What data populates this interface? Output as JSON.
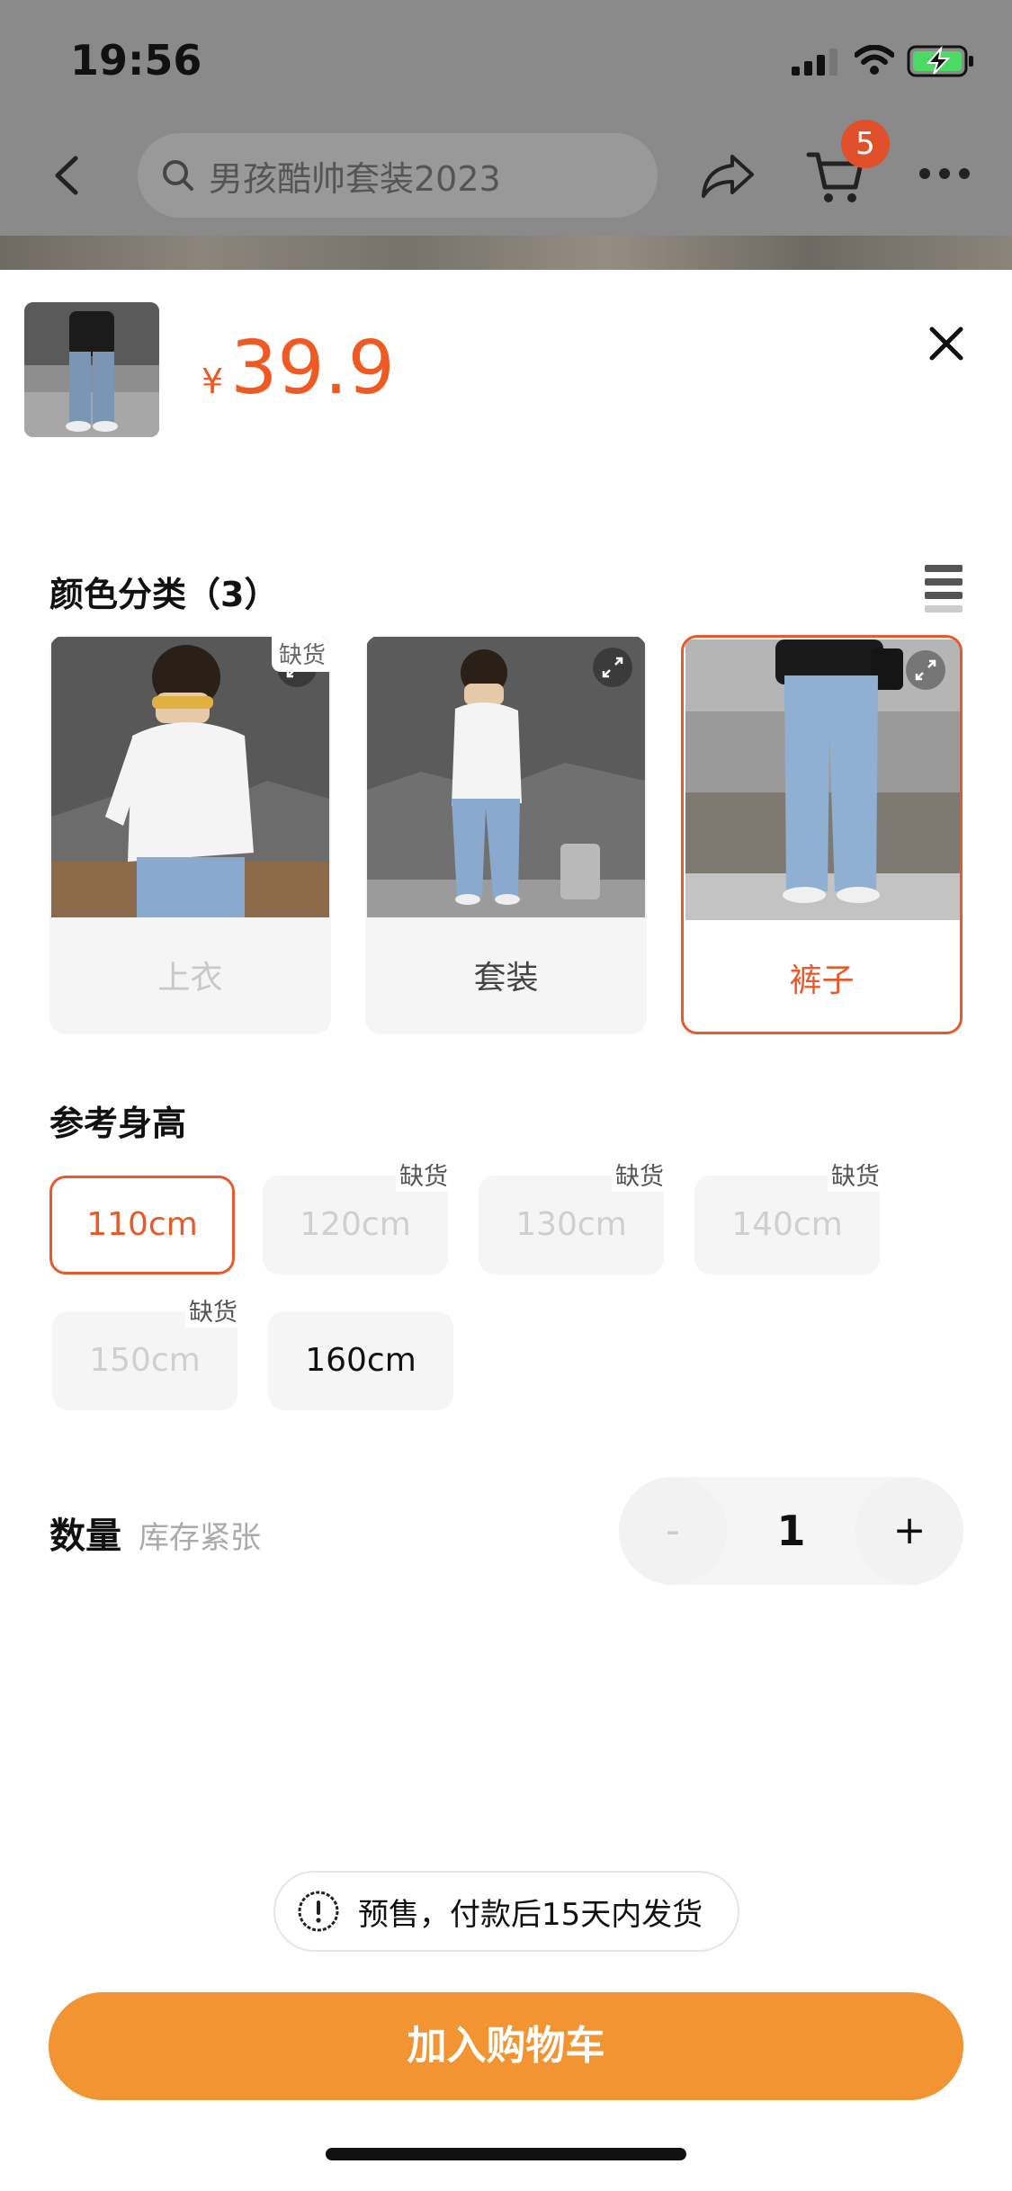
{
  "status": {
    "time": "19:56"
  },
  "nav": {
    "search_query": "男孩酷帅套装2023",
    "cart_count": "5"
  },
  "product": {
    "currency": "¥",
    "price": "39.9"
  },
  "color_section": {
    "title": "颜色分类（3）",
    "options": [
      {
        "label": "上衣",
        "status": "缺货",
        "state": "disabled"
      },
      {
        "label": "套装",
        "status": "",
        "state": "normal"
      },
      {
        "label": "裤子",
        "status": "",
        "state": "selected"
      }
    ]
  },
  "size_section": {
    "title": "参考身高",
    "options": [
      {
        "label": "110cm",
        "status": "",
        "state": "selected"
      },
      {
        "label": "120cm",
        "status": "缺货",
        "state": "disabled"
      },
      {
        "label": "130cm",
        "status": "缺货",
        "state": "disabled"
      },
      {
        "label": "140cm",
        "status": "缺货",
        "state": "disabled"
      },
      {
        "label": "150cm",
        "status": "缺货",
        "state": "disabled"
      },
      {
        "label": "160cm",
        "status": "",
        "state": "normal"
      }
    ]
  },
  "quantity": {
    "label": "数量",
    "hint": "库存紧张",
    "minus": "-",
    "value": "1",
    "plus": "+"
  },
  "notice": {
    "text": "预售，付款后15天内发货"
  },
  "cta": {
    "label": "加入购物车"
  },
  "colors": {
    "accent": "#e85a2a",
    "cta": "#f29431"
  }
}
